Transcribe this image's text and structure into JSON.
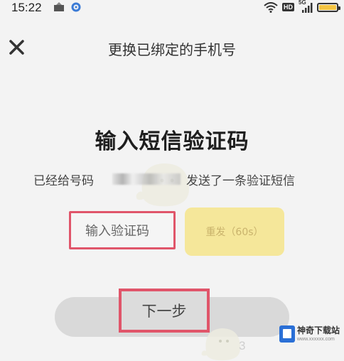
{
  "status_bar": {
    "time": "15:22",
    "hd_badge": "HD",
    "network": "5G",
    "icons": [
      "app-notification-icon",
      "gear-icon",
      "wifi-icon",
      "signal-icon",
      "battery-icon"
    ],
    "battery_color": "#f5c542"
  },
  "header": {
    "close_icon": "close-icon",
    "title": "更换已绑定的手机号"
  },
  "main": {
    "heading": "输入短信验证码",
    "sent_prefix": "已经给号码",
    "sent_suffix": "发送了一条验证短信",
    "code_input_placeholder": "输入验证码",
    "send_button_label": "重发（60s）",
    "next_button_label": "下一步"
  },
  "overlay": {
    "watermark": "3",
    "brand_name": "神奇下载站",
    "brand_url": "www.xxxxxx.com",
    "highlight_color": "#e0556a"
  }
}
